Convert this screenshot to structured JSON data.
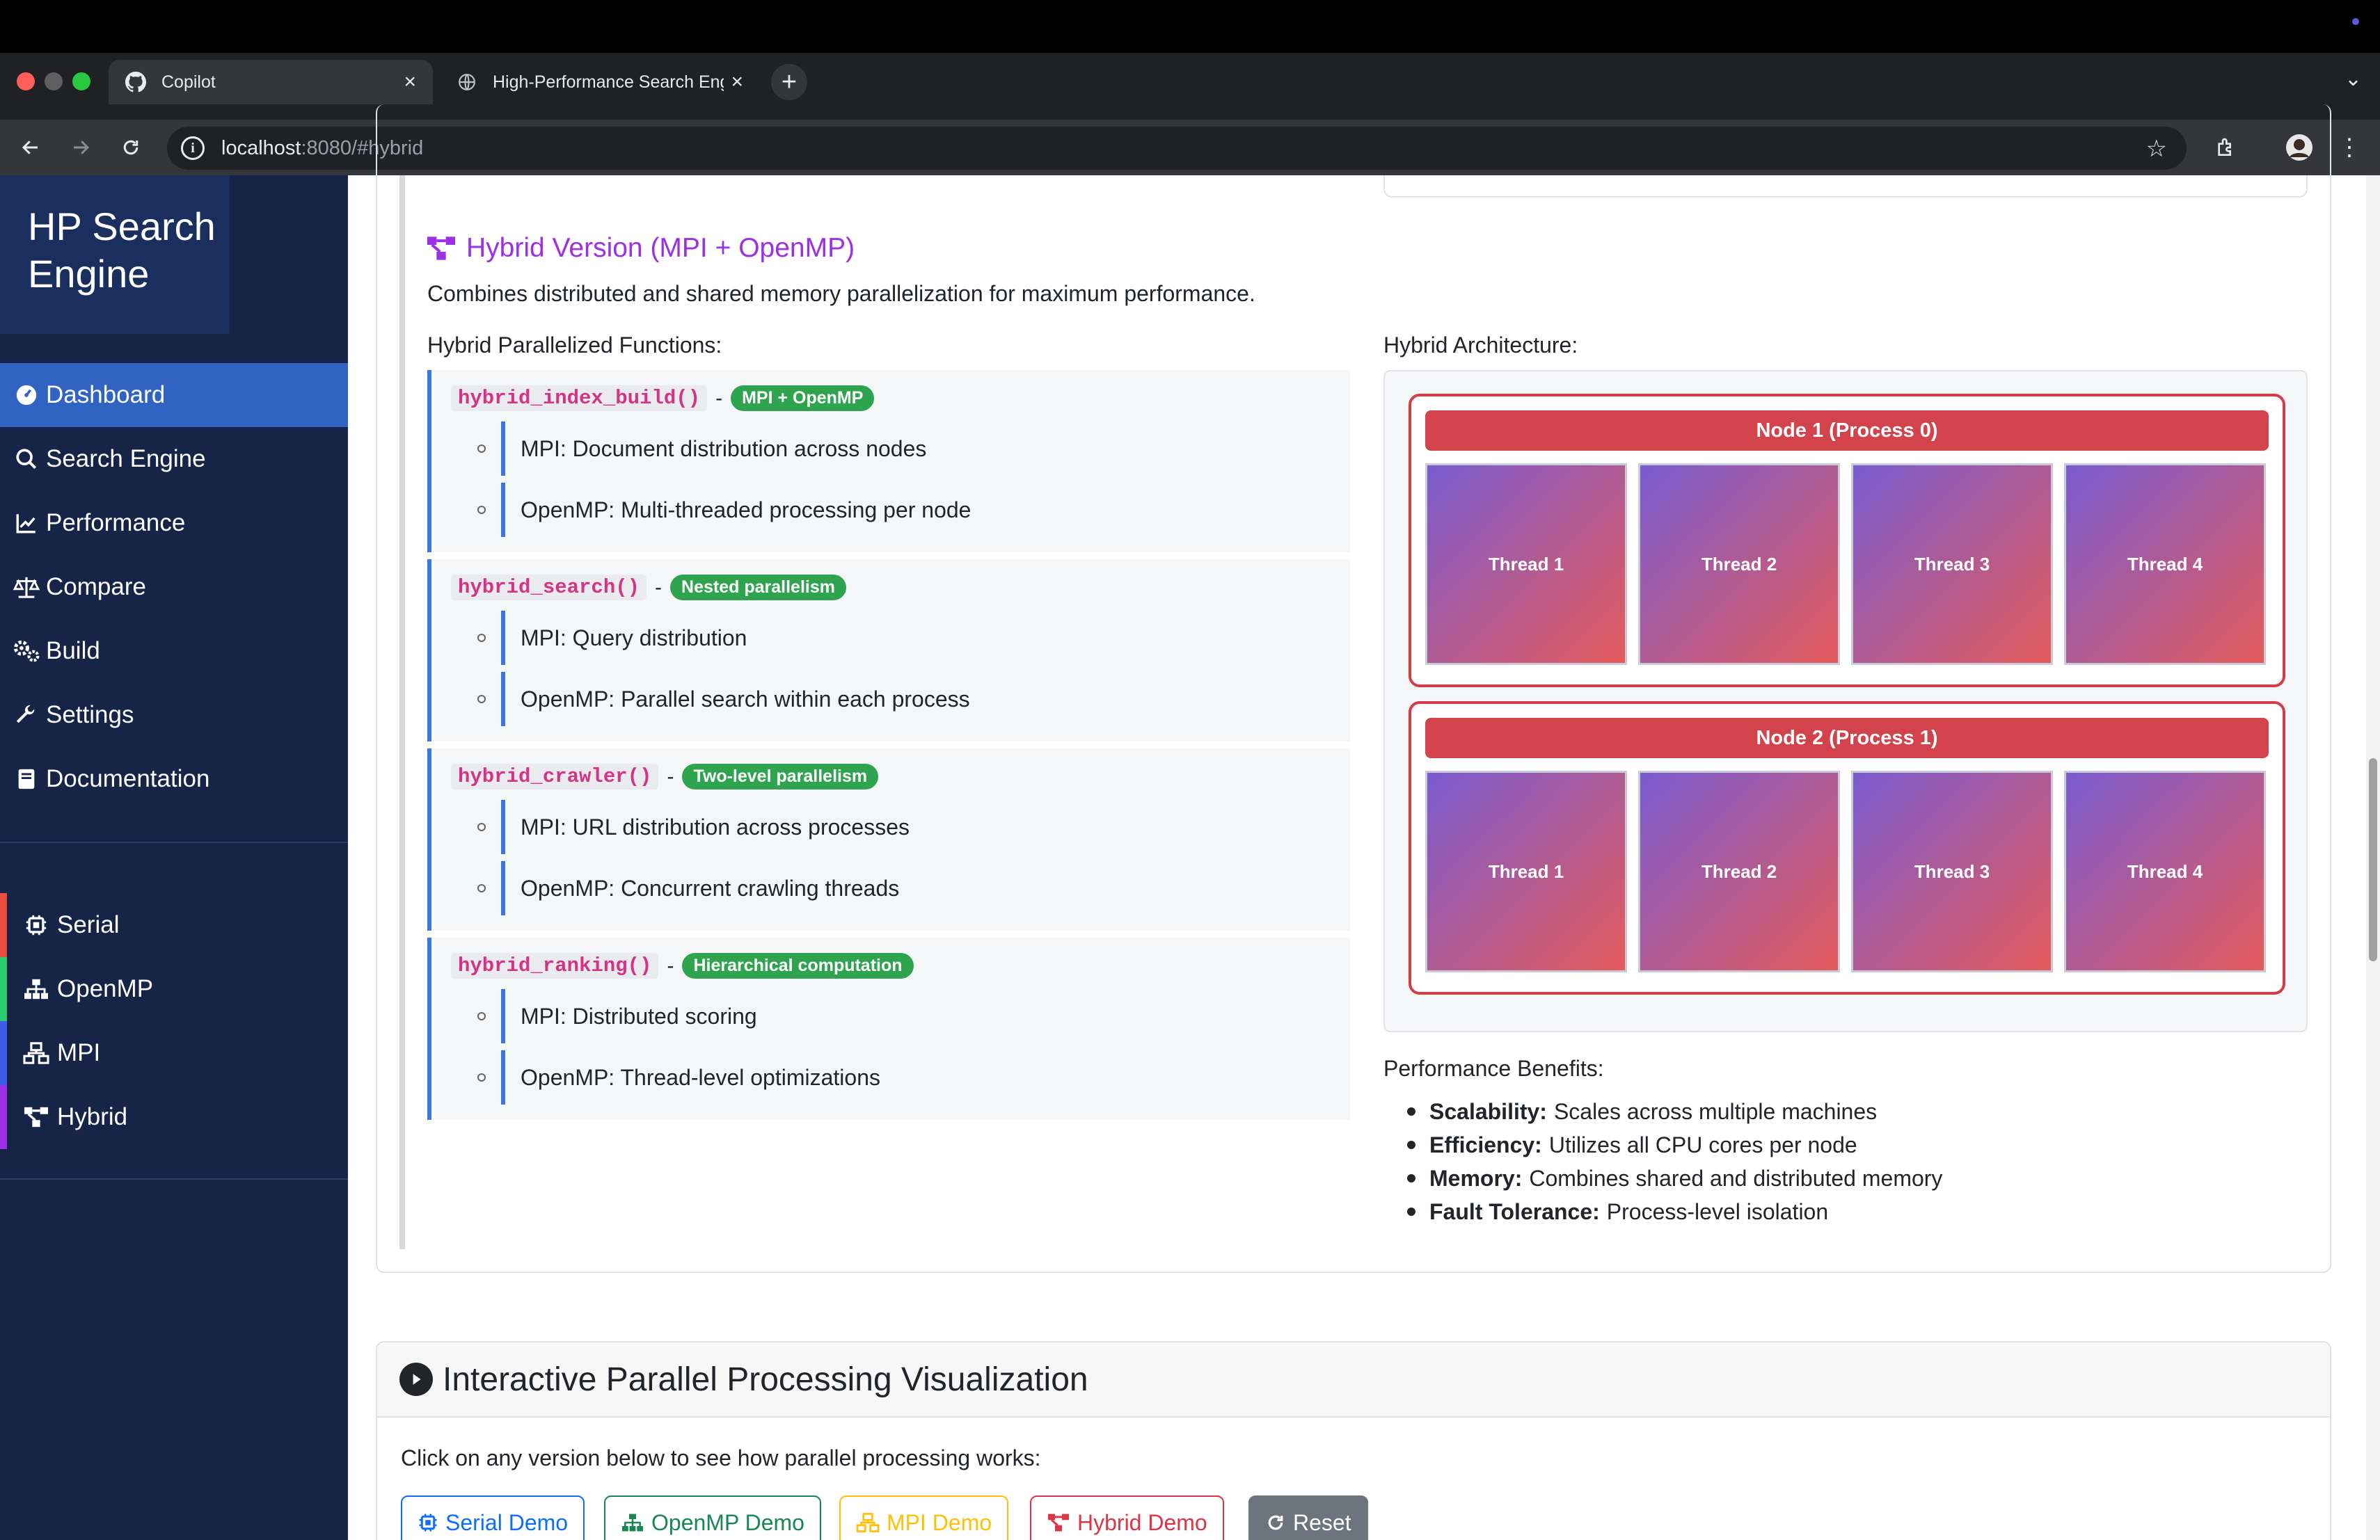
{
  "browser": {
    "tabs": [
      {
        "title": "Copilot",
        "active": true,
        "icon": "github-icon"
      },
      {
        "title": "High-Performance Search Engine",
        "active": false,
        "icon": "globe-icon"
      }
    ],
    "url_host": "localhost",
    "url_rest": ":8080/#hybrid"
  },
  "sidebar": {
    "brand": "HP Search Engine",
    "items": [
      {
        "label": "Dashboard",
        "icon": "dashboard-icon"
      },
      {
        "label": "Search Engine",
        "icon": "search-icon"
      },
      {
        "label": "Performance",
        "icon": "chart-line-icon"
      },
      {
        "label": "Compare",
        "icon": "balance-scale-icon"
      },
      {
        "label": "Build",
        "icon": "cogs-icon"
      },
      {
        "label": "Settings",
        "icon": "wrench-icon"
      },
      {
        "label": "Documentation",
        "icon": "book-icon"
      }
    ],
    "versions": [
      {
        "label": "Serial",
        "icon": "microchip-icon",
        "color": "#e74c3c"
      },
      {
        "label": "OpenMP",
        "icon": "sitemap-icon",
        "color": "#2ecc71"
      },
      {
        "label": "MPI",
        "icon": "network-icon",
        "color": "#3b5de7"
      },
      {
        "label": "Hybrid",
        "icon": "project-diagram-icon",
        "color": "#9b30e6"
      }
    ]
  },
  "hybrid": {
    "title": "Hybrid Version (MPI + OpenMP)",
    "description": "Combines distributed and shared memory parallelization for maximum performance.",
    "functions_heading": "Hybrid Parallelized Functions:",
    "functions": [
      {
        "name": "hybrid_index_build()",
        "badge": "MPI + OpenMP",
        "items": [
          "MPI: Document distribution across nodes",
          "OpenMP: Multi-threaded processing per node"
        ]
      },
      {
        "name": "hybrid_search()",
        "badge": "Nested parallelism",
        "items": [
          "MPI: Query distribution",
          "OpenMP: Parallel search within each process"
        ]
      },
      {
        "name": "hybrid_crawler()",
        "badge": "Two-level parallelism",
        "items": [
          "MPI: URL distribution across processes",
          "OpenMP: Concurrent crawling threads"
        ]
      },
      {
        "name": "hybrid_ranking()",
        "badge": "Hierarchical computation",
        "items": [
          "MPI: Distributed scoring",
          "OpenMP: Thread-level optimizations"
        ]
      }
    ],
    "architecture_heading": "Hybrid Architecture:",
    "nodes": [
      {
        "title": "Node 1 (Process 0)",
        "threads": [
          "Thread 1",
          "Thread 2",
          "Thread 3",
          "Thread 4"
        ]
      },
      {
        "title": "Node 2 (Process 1)",
        "threads": [
          "Thread 1",
          "Thread 2",
          "Thread 3",
          "Thread 4"
        ]
      }
    ],
    "benefits_heading": "Performance Benefits:",
    "benefits": [
      {
        "term": "Scalability:",
        "text": "Scales across multiple machines"
      },
      {
        "term": "Efficiency:",
        "text": "Utilizes all CPU cores per node"
      },
      {
        "term": "Memory:",
        "text": "Combines shared and distributed memory"
      },
      {
        "term": "Fault Tolerance:",
        "text": "Process-level isolation"
      }
    ]
  },
  "visualization": {
    "title": "Interactive Parallel Processing Visualization",
    "description": "Click on any version below to see how parallel processing works:",
    "buttons": [
      {
        "label": "Serial Demo",
        "icon": "microchip-icon",
        "color": "#0d6efd"
      },
      {
        "label": "OpenMP Demo",
        "icon": "sitemap-icon",
        "color": "#198754"
      },
      {
        "label": "MPI Demo",
        "icon": "network-icon",
        "color": "#ffc107"
      },
      {
        "label": "Hybrid Demo",
        "icon": "project-diagram-icon",
        "color": "#dc3545"
      },
      {
        "label": "Reset",
        "icon": "redo-icon",
        "color": "#6c757d"
      }
    ]
  }
}
